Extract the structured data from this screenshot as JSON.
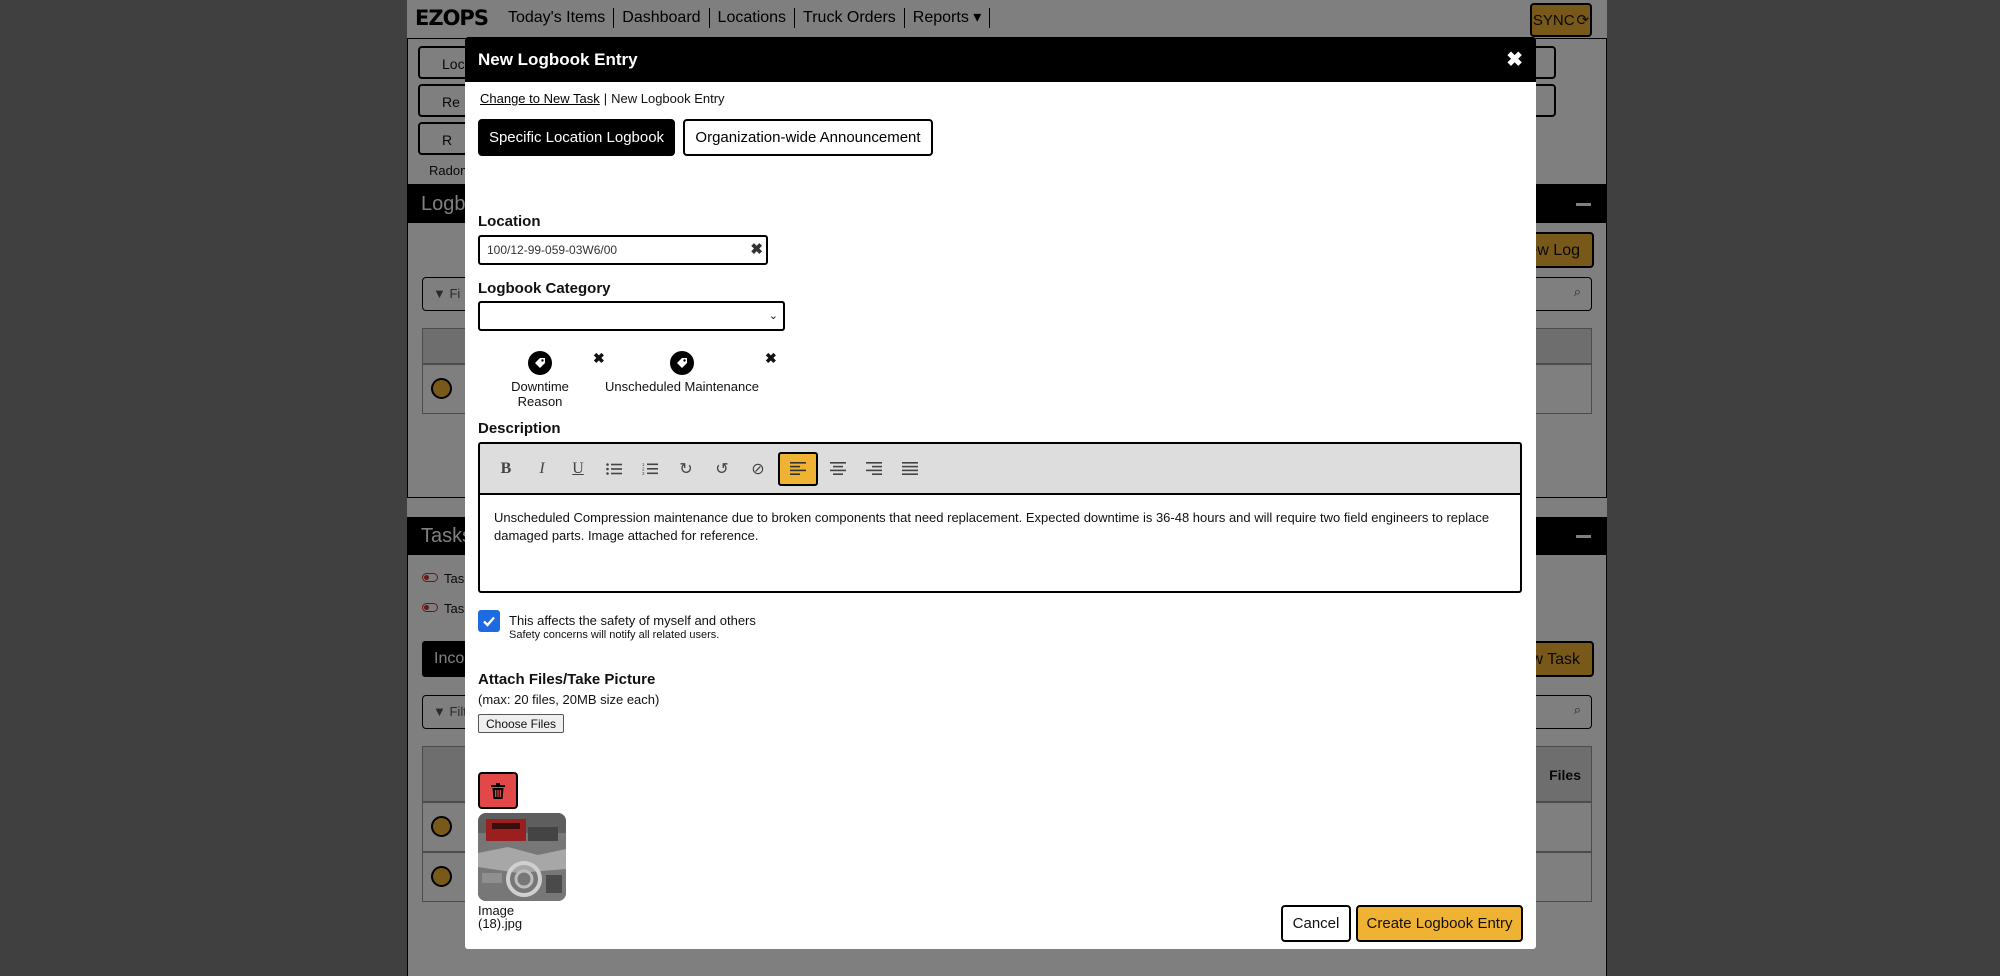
{
  "background": {
    "logo": "EZOPS",
    "nav": [
      "Today's Items",
      "Dashboard",
      "Locations",
      "Truck Orders",
      "Reports"
    ],
    "sync_label": "SYNC",
    "filter_buttons": [
      "Loc",
      "Re",
      "R"
    ],
    "small_label": "Radon",
    "logbook_section": {
      "title": "Logbo",
      "new_button": "New Log",
      "search_placeholder": "Fi"
    },
    "tasks_section": {
      "title": "Tasks",
      "toggles": [
        "Task",
        "Task"
      ],
      "tab_label": "Incor",
      "new_button": "New Task",
      "search_placeholder": "Filte",
      "files_header": "Files"
    }
  },
  "modal": {
    "title": "New Logbook Entry",
    "breadcrumb": {
      "link": "Change to New Task",
      "current": "New Logbook Entry"
    },
    "mode_tabs": {
      "active": "Specific Location Logbook",
      "inactive": "Organization-wide Announcement"
    },
    "location": {
      "label": "Location",
      "value": "100/12-99-059-03W6/00"
    },
    "category": {
      "label": "Logbook Category",
      "value": ""
    },
    "tags": [
      "Downtime Reason",
      "Unscheduled Maintenance"
    ],
    "description": {
      "label": "Description",
      "text": "Unscheduled Compression maintenance due to broken components that need replacement.  Expected downtime is 36-48 hours and will require two field engineers to replace damaged parts.  Image attached for reference."
    },
    "safety": {
      "checked": true,
      "label": "This affects the safety of myself and others",
      "note": "Safety concerns will notify all related users."
    },
    "attach": {
      "title": "Attach Files/Take Picture",
      "limits": "(max: 20 files, 20MB size each)",
      "choose_label": "Choose Files",
      "file_name_line1": "Image",
      "file_name_line2": "(18).jpg"
    },
    "buttons": {
      "cancel": "Cancel",
      "create": "Create Logbook Entry"
    }
  },
  "colors": {
    "accent": "#f0b233",
    "danger": "#e24848",
    "checkbox": "#1e6ae0",
    "header": "#000000"
  }
}
